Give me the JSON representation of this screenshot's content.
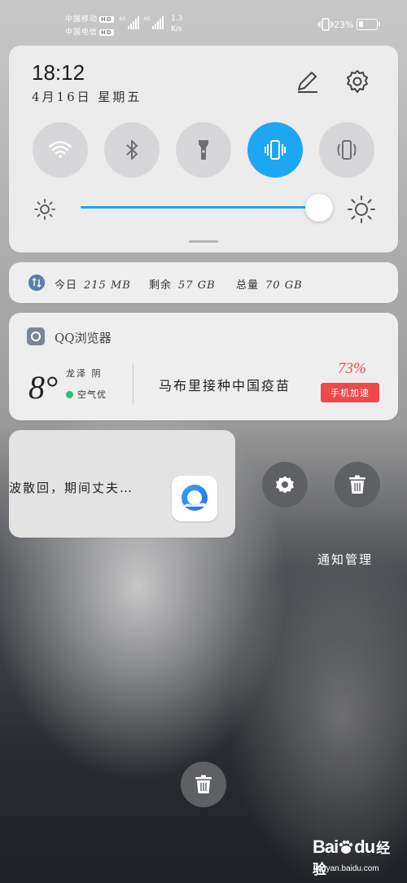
{
  "status_bar": {
    "carrier1": "中国移动",
    "carrier2": "中国电信",
    "hd": "HD",
    "network_type": "4G",
    "net_speed_value": "1.3",
    "net_speed_unit": "K/s",
    "battery_percent": "23%",
    "battery_level": 0.23
  },
  "quick_settings": {
    "time": "18:12",
    "date": "4月16日 星期五",
    "tiles": [
      {
        "name": "wifi",
        "active": false
      },
      {
        "name": "bluetooth",
        "active": false
      },
      {
        "name": "flashlight",
        "active": false
      },
      {
        "name": "vibrate",
        "active": true
      },
      {
        "name": "auto-rotate",
        "active": false
      }
    ],
    "brightness_level": 0.97,
    "accent_color": "#1da7f2"
  },
  "data_usage": {
    "today_label": "今日",
    "today_value": "215 MB",
    "remaining_label": "剩余",
    "remaining_value": "57 GB",
    "total_label": "总量",
    "total_value": "70 GB"
  },
  "weather_card": {
    "app_name": "QQ浏览器",
    "temperature": "8°",
    "location": "龙泽 阴",
    "air_quality": "空气优",
    "headline": "马布里接种中国疫苗",
    "percent": "73%",
    "boost_button": "手机加速",
    "alert_color": "#ef4a4a"
  },
  "notification": {
    "text": "波散回，期间丈夫…"
  },
  "actions": {
    "manage_label": "通知管理"
  },
  "watermark": {
    "logo_text": "Bai",
    "logo_text2": "du",
    "logo_cn": "经验",
    "url": "jingyan.baidu.com"
  }
}
